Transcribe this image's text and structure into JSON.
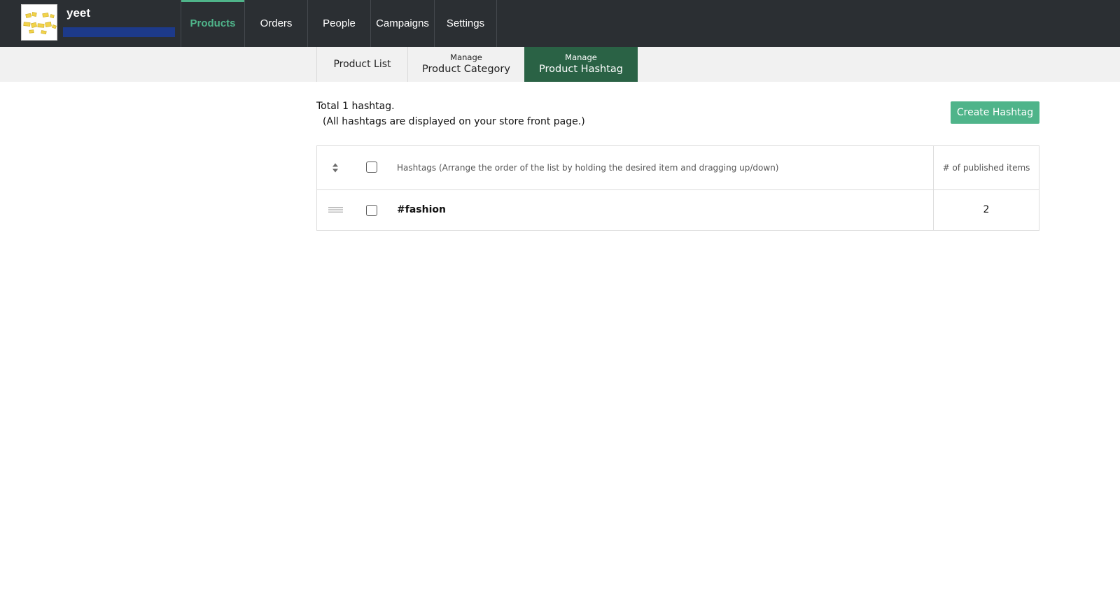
{
  "store": {
    "name": "yeet"
  },
  "nav": {
    "products": "Products",
    "orders": "Orders",
    "people": "People",
    "campaigns": "Campaigns",
    "settings": "Settings"
  },
  "subtabs": {
    "list": "Product List",
    "category_small": "Manage",
    "category_big": "Product Category",
    "hashtag_small": "Manage",
    "hashtag_big": "Product Hashtag"
  },
  "summary": {
    "total": "Total 1 hashtag.",
    "note": "(All hashtags are displayed on your store front page.)"
  },
  "create_button": "Create Hashtag",
  "table": {
    "header_hashtags": "Hashtags (Arrange the order of the list by holding the desired item and dragging up/down)",
    "header_count": "# of published items",
    "rows": [
      {
        "hashtag": "#fashion",
        "count": "2"
      }
    ]
  },
  "colors": {
    "topbar": "#2b2f33",
    "accent": "#4fb48a",
    "active_subtab": "#2a6245",
    "subbar": "#f1f1f1"
  },
  "icons": [
    "sort-icon",
    "drag-handle-icon",
    "checkbox"
  ]
}
